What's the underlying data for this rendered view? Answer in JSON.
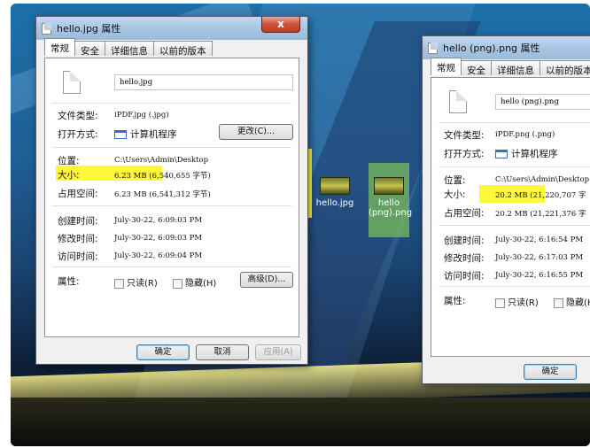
{
  "win1": {
    "title": "hello.jpg 属性",
    "close": "x",
    "tabs": [
      "常规",
      "安全",
      "详细信息",
      "以前的版本"
    ],
    "filename": "hello.jpg",
    "type_label": "文件类型:",
    "type_value": "iPDF.jpg (.jpg)",
    "open_label": "打开方式:",
    "open_value": "计算机程序",
    "change_button": "更改(C)...",
    "location_label": "位置:",
    "location_value": "C:\\Users\\Admin\\Desktop",
    "size_label": "大小:",
    "size_value": "6.23 MB (6,540,655 字节)",
    "disk_label": "占用空间:",
    "disk_value": "6.23 MB (6,541,312 字节)",
    "created_label": "创建时间:",
    "created_value": "July-30-22, 6:09:03 PM",
    "modified_label": "修改时间:",
    "modified_value": "July-30-22, 6:09:03 PM",
    "accessed_label": "访问时间:",
    "accessed_value": "July-30-22, 6:09:04 PM",
    "attr_label": "属性:",
    "readonly": "只读(R)",
    "hidden": "隐藏(H)",
    "advanced_button": "高级(D)...",
    "ok": "确定",
    "cancel": "取消",
    "apply": "应用(A)"
  },
  "win2": {
    "title": "hello (png).png 属性",
    "tabs": [
      "常规",
      "安全",
      "详细信息",
      "以前的版本"
    ],
    "filename": "hello (png).png",
    "type_label": "文件类型:",
    "type_value": "iPDF.png (.png)",
    "open_label": "打开方式:",
    "open_value": "计算机程序",
    "location_label": "位置:",
    "location_value": "C:\\Users\\Admin\\Desktop",
    "size_label": "大小:",
    "size_value": "20.2 MB (21,220,707 字",
    "disk_label": "占用空间:",
    "disk_value": "20.2 MB (21,221,376 字",
    "created_label": "创建时间:",
    "created_value": "July-30-22, 6:16:54 PM",
    "modified_label": "修改时间:",
    "modified_value": "July-30-22, 6:17:03 PM",
    "accessed_label": "访问时间:",
    "accessed_value": "July-30-22, 6:16:55 PM",
    "attr_label": "属性:",
    "readonly": "只读(R)",
    "hidden": "隐藏(H)",
    "ok": "确定"
  },
  "desktop": {
    "icon1": "hello.jpg",
    "icon2_line1": "hello",
    "icon2_line2": "(png).png"
  },
  "colors": {
    "highlight": "#fff93a",
    "titlebar": "#a7c4e2",
    "close": "#c23b22"
  }
}
